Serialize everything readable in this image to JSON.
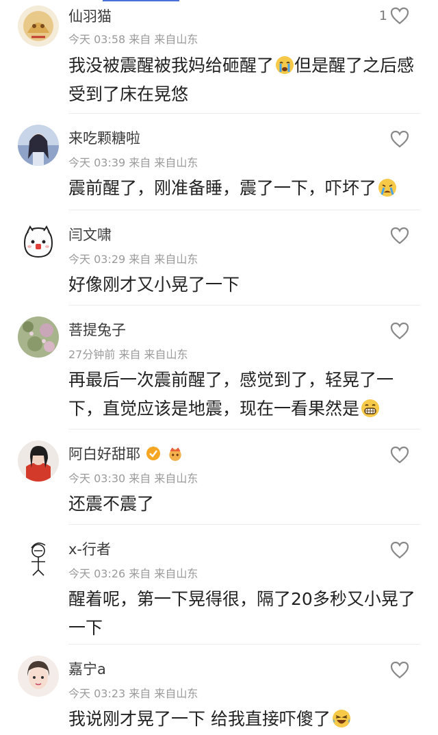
{
  "colors": {
    "accent": "#4a6fd8",
    "meta": "#9a9a9a",
    "text": "#222222"
  },
  "comments": [
    {
      "name": "仙羽猫",
      "meta": "今天 03:58 来自 来自山东",
      "text": "我没被震醒被我妈给砸醒了",
      "text_after": "但是醒了之后感受到了床在晃悠",
      "emoji": "crying-face-icon",
      "likes": "1"
    },
    {
      "name": "来吃颗糖啦",
      "meta": "今天 03:39 来自 来自山东",
      "text": "震前醒了，刚准备睡，震了一下，吓坏了",
      "text_after": "",
      "emoji": "sobbing-face-icon",
      "likes": ""
    },
    {
      "name": "闫文啸",
      "meta": "今天 03:29 来自 来自山东",
      "text": "好像刚才又小晃了一下",
      "text_after": "",
      "emoji": "",
      "likes": ""
    },
    {
      "name": "菩提兔子",
      "meta": "27分钟前 来自 来自山东",
      "text": "再最后一次震前醒了，感觉到了，轻晃了一下，直觉应该是地震，现在一看果然是",
      "text_after": "",
      "emoji": "grinning-face-icon",
      "likes": ""
    },
    {
      "name": "阿白好甜耶",
      "meta": "今天 03:30 来自 来自山东",
      "text": "还震不震了",
      "text_after": "",
      "emoji": "",
      "likes": ""
    },
    {
      "name": "x-行者",
      "meta": "今天 03:26 来自 来自山东",
      "text": "醒着呢，第一下晃得很，隔了20多秒又小晃了一下",
      "text_after": "",
      "emoji": "",
      "likes": ""
    },
    {
      "name": "嘉宁a",
      "meta": "今天 03:23 来自 来自山东",
      "text": "我说刚才晃了一下 给我直接吓傻了",
      "text_after": "",
      "emoji": "laughing-tears-icon",
      "likes": ""
    }
  ]
}
